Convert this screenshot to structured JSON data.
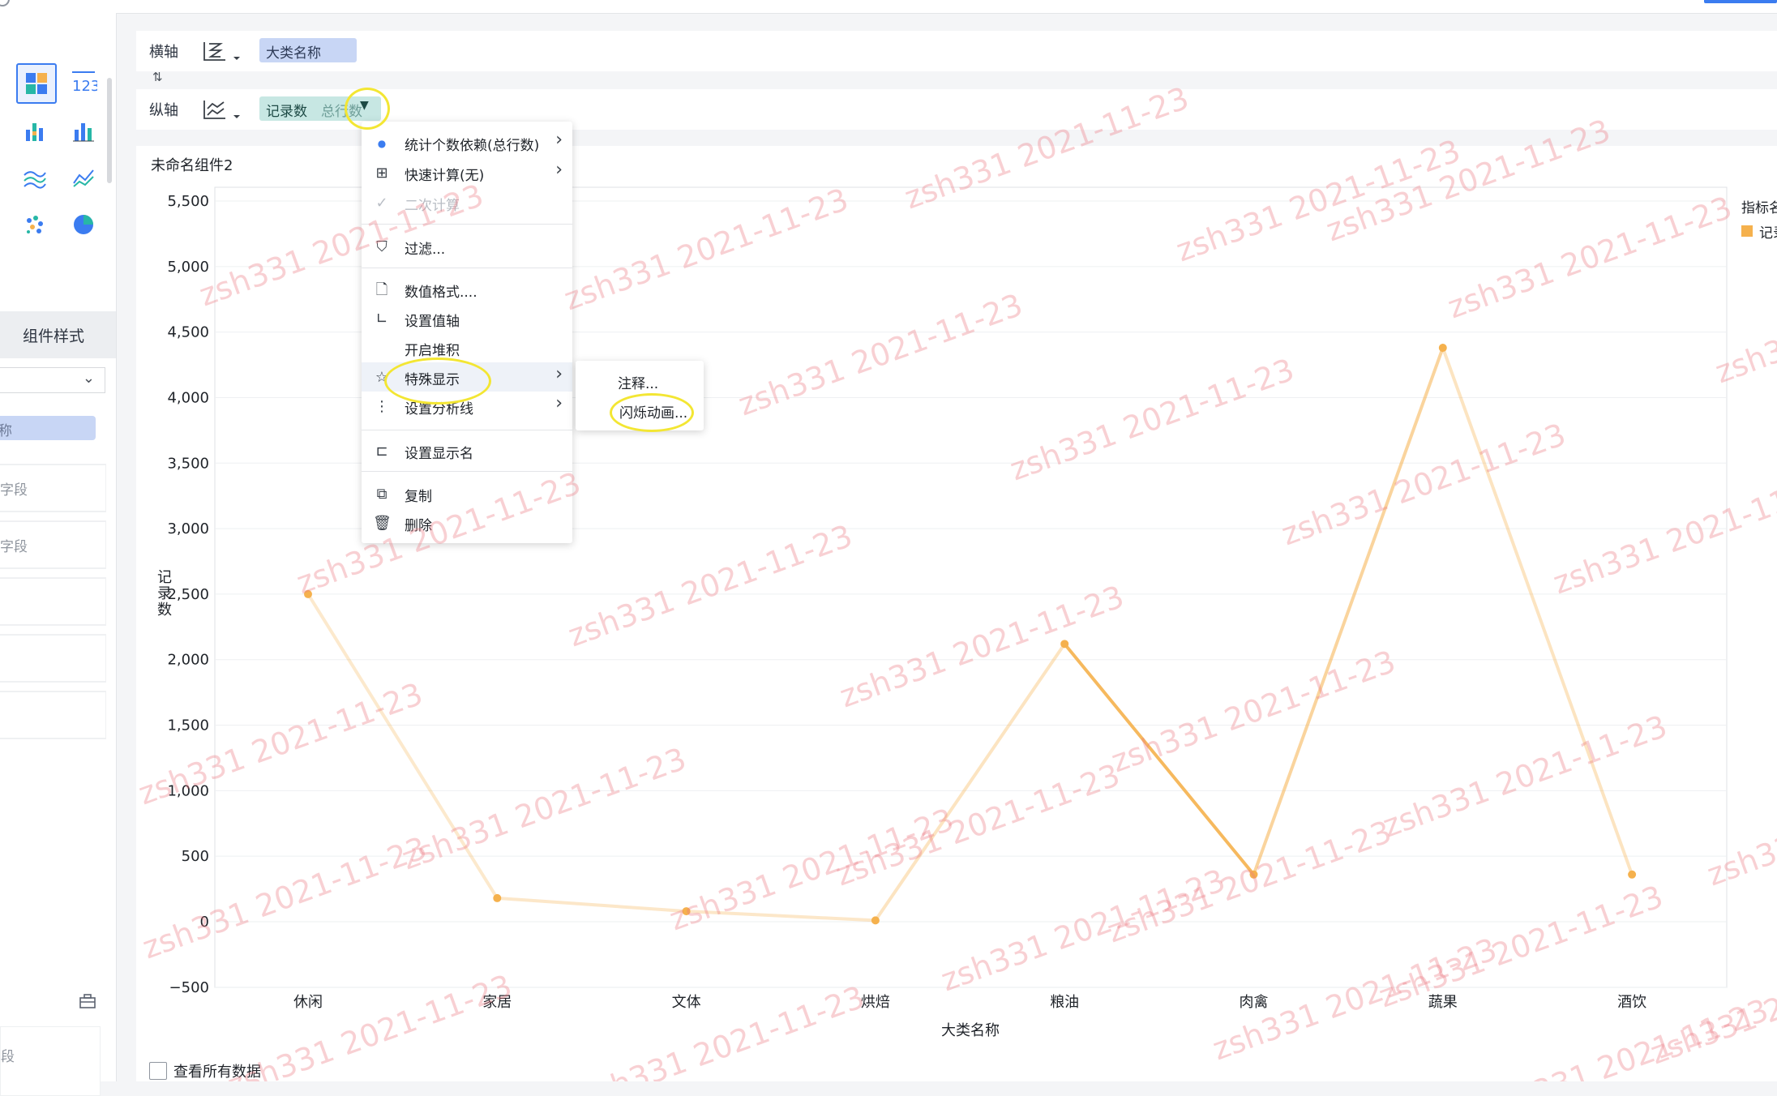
{
  "panel": {
    "style_tab": "组件样式",
    "fields": [
      "字段",
      "字段",
      "",
      "",
      ""
    ],
    "bottom_field": "段",
    "selected_pill": "称"
  },
  "axes_config": {
    "x_label": "横轴",
    "y_label": "纵轴",
    "x_field": "大类名称",
    "y_field": "记录数",
    "y_field_agg": "总行数"
  },
  "chart_card": {
    "title": "未命名组件2",
    "view_all": "查看所有数据"
  },
  "legend": {
    "title": "指标名",
    "item": "记录数"
  },
  "context_menu": {
    "items": [
      {
        "label": "统计个数依赖(总行数)",
        "icon": "dot-icon",
        "submenu": true
      },
      {
        "label": "快速计算(无)",
        "icon": "calculator-icon",
        "submenu": true
      },
      {
        "label": "二次计算",
        "icon": "check-icon",
        "disabled": true
      },
      {
        "label": "过滤...",
        "icon": "filter-icon"
      },
      {
        "label": "数值格式....",
        "icon": "number-format-icon"
      },
      {
        "label": "设置值轴",
        "icon": "value-axis-icon"
      },
      {
        "label": "开启堆积",
        "icon": ""
      },
      {
        "label": "特殊显示",
        "icon": "star-icon",
        "submenu": true
      },
      {
        "label": "设置分析线",
        "icon": "analysis-line-icon",
        "submenu": true
      },
      {
        "label": "设置显示名",
        "icon": "rename-icon"
      },
      {
        "label": "复制",
        "icon": "copy-icon"
      },
      {
        "label": "删除",
        "icon": "trash-icon"
      }
    ],
    "submenu_items": [
      "注释...",
      "闪烁动画..."
    ]
  },
  "chart_data": {
    "type": "line",
    "categories": [
      "休闲",
      "家居",
      "文体",
      "烘焙",
      "粮油",
      "肉禽",
      "蔬果",
      "酒饮"
    ],
    "series": [
      {
        "name": "记录数",
        "values": [
          2500,
          180,
          80,
          10,
          2120,
          360,
          4380,
          360
        ]
      }
    ],
    "xlabel": "大类名称",
    "ylabel": "记录数",
    "ylim": [
      -500,
      5500
    ],
    "yticks": [
      "-500",
      "0",
      "500",
      "1,000",
      "1,500",
      "2,000",
      "2,500",
      "3,000",
      "3,500",
      "4,000",
      "4,500",
      "5,000",
      "5,500"
    ],
    "grid": true,
    "legend_position": "right",
    "color": "#f5b14d"
  },
  "watermark": "zsh331 2021-11-23"
}
